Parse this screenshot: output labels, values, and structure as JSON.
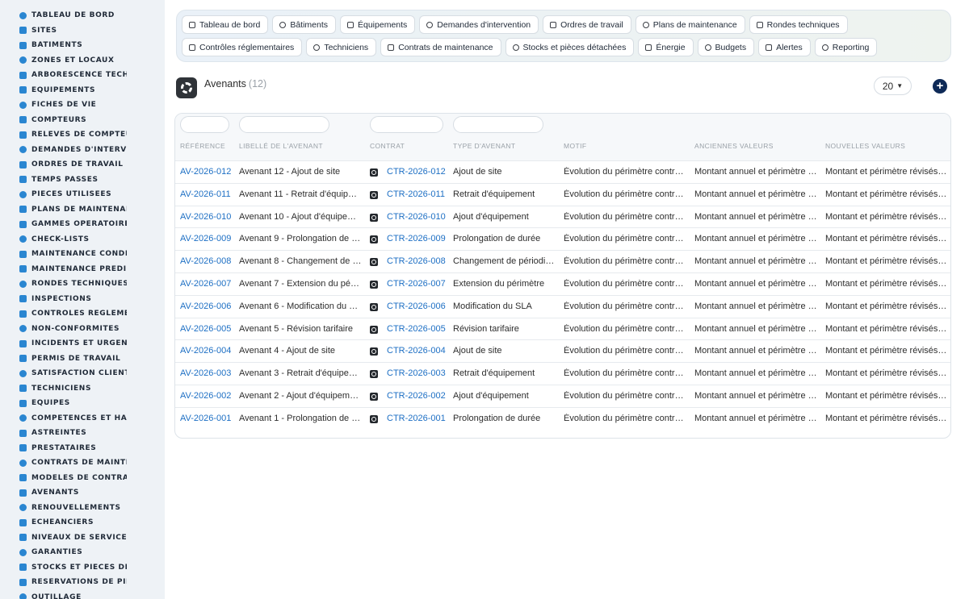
{
  "sidebar": {
    "items": [
      {
        "label": "Tableau de bord",
        "icon": "dashboard-icon"
      },
      {
        "label": "Sites",
        "icon": "location-pin-icon"
      },
      {
        "label": "Bâtiments",
        "icon": "building-icon"
      },
      {
        "label": "Zones et locaux",
        "icon": "grid-icon"
      },
      {
        "label": "Arborescence techni",
        "icon": "hierarchy-icon"
      },
      {
        "label": "Équipements",
        "icon": "cogs-icon"
      },
      {
        "label": "Fiches de vie",
        "icon": "history-icon"
      },
      {
        "label": "Compteurs",
        "icon": "gauge-icon"
      },
      {
        "label": "Relevés de compteurs",
        "icon": "clipboard-icon"
      },
      {
        "label": "Demandes d'intervent",
        "icon": "question-icon"
      },
      {
        "label": "Ordres de travail",
        "icon": "clipboard-check-icon"
      },
      {
        "label": "Temps passés",
        "icon": "clock-icon"
      },
      {
        "label": "Pièces utilisées",
        "icon": "boxes-icon"
      },
      {
        "label": "Plans de maintenance",
        "icon": "calendar-icon"
      },
      {
        "label": "Gammes opératoires",
        "icon": "tasks-icon"
      },
      {
        "label": "Check-lists",
        "icon": "list-icon"
      },
      {
        "label": "Maintenance conditio",
        "icon": "thermometer-icon"
      },
      {
        "label": "Maintenance prédicti",
        "icon": "chart-line-icon"
      },
      {
        "label": "Rondes techniques",
        "icon": "route-icon"
      },
      {
        "label": "Inspections",
        "icon": "magnifier-icon"
      },
      {
        "label": "Contrôles réglement",
        "icon": "clipboard-icon"
      },
      {
        "label": "Non-conformités",
        "icon": "alert-circle-icon"
      },
      {
        "label": "Incidents et urgences",
        "icon": "warning-icon"
      },
      {
        "label": "Permis de travail",
        "icon": "file-icon"
      },
      {
        "label": "Satisfaction client",
        "icon": "smile-icon"
      },
      {
        "label": "Techniciens",
        "icon": "hard-hat-icon"
      },
      {
        "label": "Équipes",
        "icon": "users-icon"
      },
      {
        "label": "Compétences et habil",
        "icon": "certificate-icon"
      },
      {
        "label": "Astreintes",
        "icon": "phone-icon"
      },
      {
        "label": "Prestataires",
        "icon": "handshake-icon"
      },
      {
        "label": "Contrats de maintena",
        "icon": "file-contract-icon"
      },
      {
        "label": "Modèles de contrats",
        "icon": "file-icon"
      },
      {
        "label": "Avenants",
        "icon": "file-signature-icon"
      },
      {
        "label": "Renouvellements",
        "icon": "sync-icon"
      },
      {
        "label": "Échéanciers",
        "icon": "calendar-icon"
      },
      {
        "label": "Niveaux de service (SL",
        "icon": "tachometer-icon"
      },
      {
        "label": "Garanties",
        "icon": "shield-icon"
      },
      {
        "label": "Stocks et pièces déta",
        "icon": "warehouse-icon"
      },
      {
        "label": "Réservations de pièce",
        "icon": "bookmark-icon"
      },
      {
        "label": "Outillage",
        "icon": "tools-icon"
      }
    ]
  },
  "topnav": {
    "row1": [
      {
        "label": "Tableau de bord",
        "icon": "dashboard-icon"
      },
      {
        "label": "Bâtiments",
        "icon": "building-icon"
      },
      {
        "label": "Équipements",
        "icon": "cogs-icon"
      },
      {
        "label": "Demandes d'intervention",
        "icon": "question-icon"
      },
      {
        "label": "Ordres de travail",
        "icon": "clipboard-check-icon"
      },
      {
        "label": "Plans de maintenance",
        "icon": "calendar-icon"
      },
      {
        "label": "Rondes techniques",
        "icon": "route-icon"
      }
    ],
    "row2": [
      {
        "label": "Contrôles réglementaires",
        "icon": "clipboard-icon"
      },
      {
        "label": "Techniciens",
        "icon": "hard-hat-icon"
      },
      {
        "label": "Contrats de maintenance",
        "icon": "file-contract-icon"
      },
      {
        "label": "Stocks et pièces détachées",
        "icon": "boxes-icon"
      },
      {
        "label": "Énergie",
        "icon": "bolt-icon"
      },
      {
        "label": "Budgets",
        "icon": "money-icon"
      },
      {
        "label": "Alertes",
        "icon": "bell-icon"
      },
      {
        "label": "Reporting",
        "icon": "pie-chart-icon"
      }
    ]
  },
  "header": {
    "title": "Avenants",
    "count": "(12)",
    "per_page": "20",
    "add_label": "+"
  },
  "table": {
    "columns": [
      "Référence",
      "Libellé de l'avenant",
      "Contrat",
      "Type d'avenant",
      "Motif",
      "Anciennes valeurs",
      "Nouvelles valeurs"
    ],
    "rows": [
      {
        "ref": "AV-2026-012",
        "label": "Avenant 12 - Ajout de site",
        "contract": "CTR-2026-012",
        "type": "Ajout de site",
        "motif": "Évolution du périmètre contra…",
        "old": "Montant annuel et périmètre i…",
        "new": "Montant et périmètre révisés …"
      },
      {
        "ref": "AV-2026-011",
        "label": "Avenant 11 - Retrait d'équipe…",
        "contract": "CTR-2026-011",
        "type": "Retrait d'équipement",
        "motif": "Évolution du périmètre contra…",
        "old": "Montant annuel et périmètre i…",
        "new": "Montant et périmètre révisés …"
      },
      {
        "ref": "AV-2026-010",
        "label": "Avenant 10 - Ajout d'équipem…",
        "contract": "CTR-2026-010",
        "type": "Ajout d'équipement",
        "motif": "Évolution du périmètre contra…",
        "old": "Montant annuel et périmètre i…",
        "new": "Montant et périmètre révisés …"
      },
      {
        "ref": "AV-2026-009",
        "label": "Avenant 9 - Prolongation de d…",
        "contract": "CTR-2026-009",
        "type": "Prolongation de durée",
        "motif": "Évolution du périmètre contra…",
        "old": "Montant annuel et périmètre i…",
        "new": "Montant et périmètre révisés …"
      },
      {
        "ref": "AV-2026-008",
        "label": "Avenant 8 - Changement de …",
        "contract": "CTR-2026-008",
        "type": "Changement de périodicité",
        "motif": "Évolution du périmètre contra…",
        "old": "Montant annuel et périmètre i…",
        "new": "Montant et périmètre révisés …"
      },
      {
        "ref": "AV-2026-007",
        "label": "Avenant 7 - Extension du péri…",
        "contract": "CTR-2026-007",
        "type": "Extension du périmètre",
        "motif": "Évolution du périmètre contra…",
        "old": "Montant annuel et périmètre i…",
        "new": "Montant et périmètre révisés …"
      },
      {
        "ref": "AV-2026-006",
        "label": "Avenant 6 - Modification du SLA",
        "contract": "CTR-2026-006",
        "type": "Modification du SLA",
        "motif": "Évolution du périmètre contra…",
        "old": "Montant annuel et périmètre i…",
        "new": "Montant et périmètre révisés …"
      },
      {
        "ref": "AV-2026-005",
        "label": "Avenant 5 - Révision tarifaire",
        "contract": "CTR-2026-005",
        "type": "Révision tarifaire",
        "motif": "Évolution du périmètre contra…",
        "old": "Montant annuel et périmètre i…",
        "new": "Montant et périmètre révisés …"
      },
      {
        "ref": "AV-2026-004",
        "label": "Avenant 4 - Ajout de site",
        "contract": "CTR-2026-004",
        "type": "Ajout de site",
        "motif": "Évolution du périmètre contra…",
        "old": "Montant annuel et périmètre i…",
        "new": "Montant et périmètre révisés …"
      },
      {
        "ref": "AV-2026-003",
        "label": "Avenant 3 - Retrait d'équipem…",
        "contract": "CTR-2026-003",
        "type": "Retrait d'équipement",
        "motif": "Évolution du périmètre contra…",
        "old": "Montant annuel et périmètre i…",
        "new": "Montant et périmètre révisés …"
      },
      {
        "ref": "AV-2026-002",
        "label": "Avenant 2 - Ajout d'équipement",
        "contract": "CTR-2026-002",
        "type": "Ajout d'équipement",
        "motif": "Évolution du périmètre contra…",
        "old": "Montant annuel et périmètre i…",
        "new": "Montant et périmètre révisés …"
      },
      {
        "ref": "AV-2026-001",
        "label": "Avenant 1 - Prolongation de d…",
        "contract": "CTR-2026-001",
        "type": "Prolongation de durée",
        "motif": "Évolution du périmètre contra…",
        "old": "Montant annuel et périmètre i…",
        "new": "Montant et périmètre révisés …"
      }
    ]
  },
  "colors": {
    "accent": "#2a86d1",
    "link": "#1d6fc4",
    "add_button": "#0e2a57"
  }
}
